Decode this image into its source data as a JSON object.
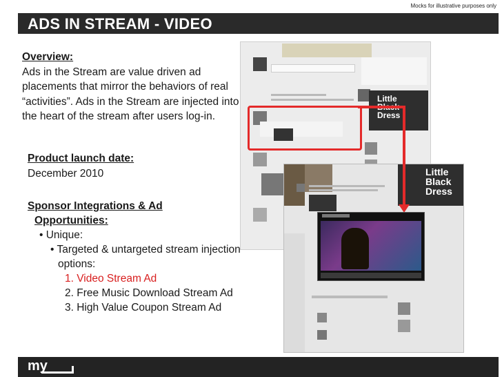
{
  "disclaimer": "Mocks for illustrative purposes only",
  "title": "ADS IN STREAM - VIDEO",
  "overview": {
    "heading": "Overview:",
    "body": "Ads in the Stream are value driven ad placements that mirror the behaviors of real “activities”. Ads in the Stream are injected into the heart of the stream after users log-in."
  },
  "launch": {
    "heading": "Product launch date:",
    "date": "December 2010"
  },
  "sponsor": {
    "heading_line1": "Sponsor Integrations & Ad",
    "heading_line2": "Opportunities:",
    "unique": "• Unique:",
    "targeted": "• Targeted & untargeted stream injection options:",
    "items": [
      "1. Video Stream Ad",
      "2. Free Music Download Stream Ad",
      "3. High Value Coupon Stream Ad"
    ]
  },
  "mockup": {
    "ad_text": "Little Black Dress",
    "highlight_color": "#e42a2a"
  },
  "footer": {
    "logo": "my"
  }
}
